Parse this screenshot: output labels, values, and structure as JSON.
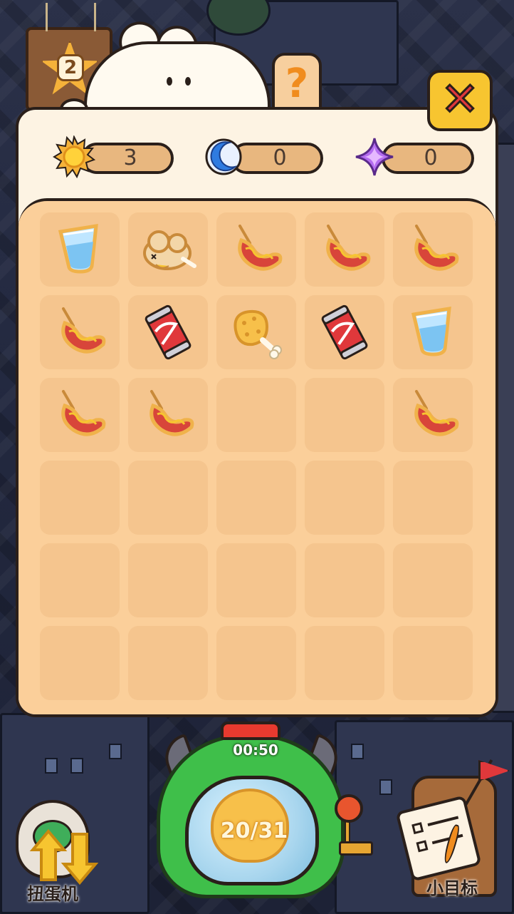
{
  "level": {
    "number": "2"
  },
  "help_button": {
    "label": "?"
  },
  "close_button": {
    "label": "✕"
  },
  "resources": [
    {
      "icon": "sun-icon",
      "value": "3"
    },
    {
      "icon": "moon-icon",
      "value": "0"
    },
    {
      "icon": "sparkle-icon",
      "value": "0"
    }
  ],
  "grid": {
    "rows": 6,
    "cols": 5,
    "cells": [
      [
        "water-cup",
        "roast-chicken",
        "sausage",
        "sausage",
        "sausage"
      ],
      [
        "sausage",
        "soda-can",
        "fried-drumstick",
        "soda-can",
        "water-cup"
      ],
      [
        "sausage",
        "sausage",
        "",
        "",
        "sausage"
      ],
      [
        "",
        "",
        "",
        "",
        ""
      ],
      [
        "",
        "",
        "",
        "",
        ""
      ],
      [
        "",
        "",
        "",
        "",
        ""
      ]
    ]
  },
  "machine": {
    "label": "扭蛋机"
  },
  "gacha": {
    "timer": "00:50",
    "count": "20/31"
  },
  "goal": {
    "label": "小目标"
  },
  "colors": {
    "panel": "#fdf3e3",
    "grid_bg": "#fbcf9a",
    "cell": "#f5c58e",
    "pill": "#e8b77f",
    "close": "#f7c530",
    "gacha_green": "#3fbf4a",
    "accent_red": "#e0383b"
  }
}
